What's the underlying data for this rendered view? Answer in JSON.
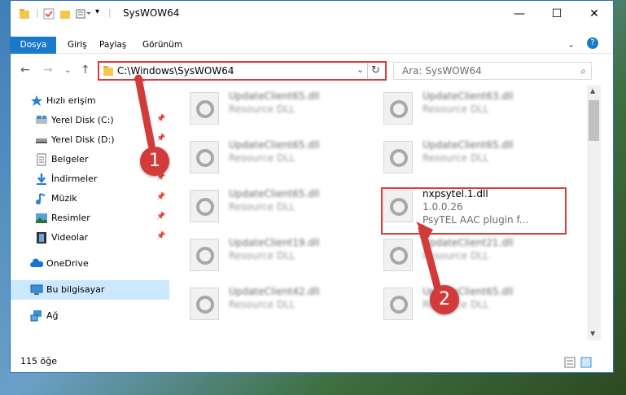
{
  "window": {
    "title": "SysWOW64"
  },
  "ribbon": {
    "tabs": [
      "Dosya",
      "Giriş",
      "Paylaş",
      "Görünüm"
    ]
  },
  "nav": {
    "address": "C:\\Windows\\SysWOW64",
    "search_placeholder": "Ara: SysWOW64"
  },
  "sidebar": {
    "items": [
      {
        "label": "Hızlı erişim",
        "icon": "star-icon"
      },
      {
        "label": "Yerel Disk (C:)",
        "icon": "drive-icon"
      },
      {
        "label": "Yerel Disk (D:)",
        "icon": "drive-icon"
      },
      {
        "label": "Belgeler",
        "icon": "documents-icon"
      },
      {
        "label": "İndirmeler",
        "icon": "download-icon"
      },
      {
        "label": "Müzik",
        "icon": "music-icon"
      },
      {
        "label": "Resimler",
        "icon": "pictures-icon"
      },
      {
        "label": "Videolar",
        "icon": "video-icon"
      },
      {
        "label": "OneDrive",
        "icon": "cloud-icon"
      },
      {
        "label": "Bu bilgisayar",
        "icon": "computer-icon"
      },
      {
        "label": "Ağ",
        "icon": "network-icon"
      }
    ]
  },
  "files": [
    {
      "name": "UpdateClient65.dll",
      "sub": "Resource DLL"
    },
    {
      "name": "UpdateClient63.dll",
      "sub": "Resource DLL"
    },
    {
      "name": "UpdateClient65.dll",
      "sub": "Resource DLL"
    },
    {
      "name": "UpdateClient65.dll",
      "sub": "Resource DLL"
    },
    {
      "name": "UpdateClient65.dll",
      "sub": "Resource DLL"
    },
    {
      "name": "nxpsytel.1.dll",
      "sub": "1.0.0.26",
      "sub2": "PsyTEL AAC plugin f..."
    },
    {
      "name": "UpdateClient19.dll",
      "sub": "Resource DLL"
    },
    {
      "name": "UpdateClient21.dll",
      "sub": "Resource DLL"
    },
    {
      "name": "UpdateClient42.dll",
      "sub": "Resource DLL"
    },
    {
      "name": "UpdateClient65.dll",
      "sub": "Resource DLL"
    }
  ],
  "status": {
    "count": "115 öğe"
  },
  "callouts": [
    "1",
    "2"
  ],
  "colors": {
    "accent": "#1979ca",
    "highlight": "#d93c3c",
    "selection": "#cce8ff"
  }
}
